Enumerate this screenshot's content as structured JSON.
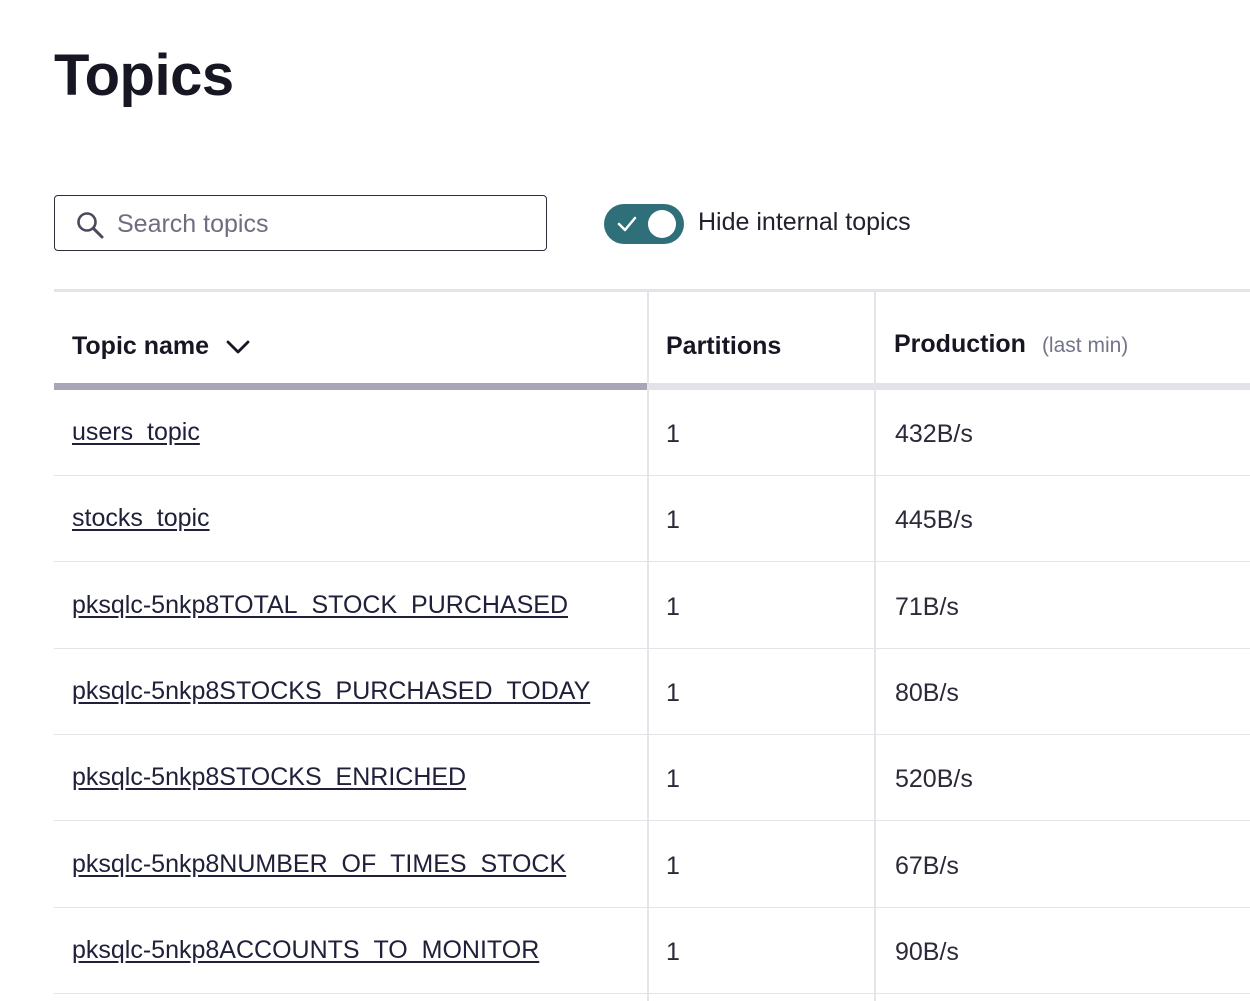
{
  "page": {
    "title": "Topics"
  },
  "search": {
    "placeholder": "Search topics",
    "value": "",
    "icon": "search-icon"
  },
  "toggle": {
    "label": "Hide internal topics",
    "on": true,
    "color": "#2f6f7a"
  },
  "table": {
    "columns": {
      "name": "Topic name",
      "partitions": "Partitions",
      "production": "Production",
      "production_sub": "(last min)"
    },
    "sort": {
      "column": "name",
      "direction": "desc"
    },
    "rows": [
      {
        "name": "users_topic",
        "partitions": "1",
        "production": "432B/s"
      },
      {
        "name": "stocks_topic",
        "partitions": "1",
        "production": "445B/s"
      },
      {
        "name": "pksqlc-5nkp8TOTAL_STOCK_PURCHASED",
        "partitions": "1",
        "production": "71B/s"
      },
      {
        "name": "pksqlc-5nkp8STOCKS_PURCHASED_TODAY",
        "partitions": "1",
        "production": "80B/s"
      },
      {
        "name": "pksqlc-5nkp8STOCKS_ENRICHED",
        "partitions": "1",
        "production": "520B/s"
      },
      {
        "name": "pksqlc-5nkp8NUMBER_OF_TIMES_STOCK",
        "partitions": "1",
        "production": "67B/s"
      },
      {
        "name": "pksqlc-5nkp8ACCOUNTS_TO_MONITOR",
        "partitions": "1",
        "production": "90B/s"
      }
    ]
  }
}
